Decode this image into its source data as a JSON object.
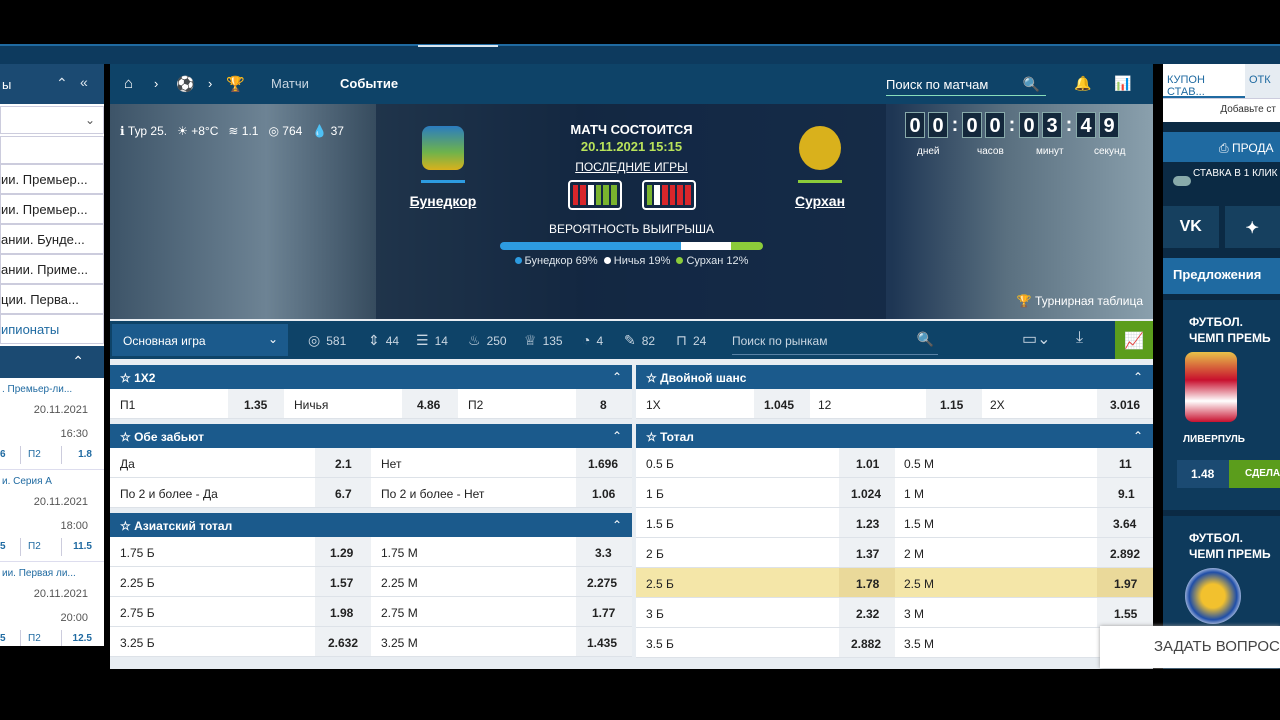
{
  "sidebar": {
    "header_text": "ы",
    "leagues": [
      "ии. Премьер...",
      "ии. Премьер...",
      "ании. Бунде...",
      "ании. Приме...",
      "ции. Перва..."
    ],
    "leagues_link": "ипионаты",
    "matches": [
      {
        "league": ". Премьер-ли...",
        "date": "20.11.2021",
        "time": "16:30",
        "v1": "6",
        "p2": "П2",
        "v2": "1.8"
      },
      {
        "league": "и. Серия А",
        "date": "20.11.2021",
        "time": "18:00",
        "v1": "5",
        "p2": "П2",
        "v2": "11.5"
      },
      {
        "league": "ии. Первая ли...",
        "date": "20.11.2021",
        "time": "20:00",
        "v1": "5",
        "p2": "П2",
        "v2": "12.5"
      }
    ]
  },
  "nav": {
    "matches": "Матчи",
    "event": "Событие",
    "search": "Поиск по матчам"
  },
  "hero": {
    "stats": {
      "round": "Тур 25.",
      "temp": "+8°C",
      "wind": "1.1",
      "pressure": "764",
      "humidity": "37"
    },
    "status": "МАТЧ СОСТОИТСЯ",
    "datetime": "20.11.2021 15:15",
    "last_games": "ПОСЛЕДНИЕ ИГРЫ",
    "win_prob": "ВЕРОЯТНОСТЬ ВЫИГРЫША",
    "home": "Бунедкор",
    "away": "Сурхан",
    "prob_home": "Бунедкор 69%",
    "prob_draw": "Ничья 19%",
    "prob_away": "Сурхан 12%",
    "prob_values": {
      "home": 69,
      "draw": 19,
      "away": 12
    },
    "timer_digits": [
      "0",
      "0",
      "0",
      "0",
      "0",
      "3",
      "4",
      "9"
    ],
    "timer_labels": [
      "дней",
      "часов",
      "минут",
      "секунд"
    ],
    "tournament": "Турнирная таблица"
  },
  "markets_bar": {
    "dropdown": "Основная игра",
    "filters": [
      "581",
      "44",
      "14",
      "250",
      "135",
      "4",
      "82",
      "24"
    ],
    "search": "Поиск по рынкам"
  },
  "t1x2": {
    "title": "1X2",
    "cells": [
      [
        "П1",
        "1.35"
      ],
      [
        "Ничья",
        "4.86"
      ],
      [
        "П2",
        "8"
      ]
    ]
  },
  "tboth": {
    "title": "Обе забьют",
    "rows": [
      [
        "Да",
        "2.1",
        "Нет",
        "1.696"
      ],
      [
        "По 2 и более - Да",
        "6.7",
        "По 2 и более - Нет",
        "1.06"
      ]
    ]
  },
  "tasian": {
    "title": "Азиатский тотал",
    "rows": [
      [
        "1.75 Б",
        "1.29",
        "1.75 М",
        "3.3"
      ],
      [
        "2.25 Б",
        "1.57",
        "2.25 М",
        "2.275"
      ],
      [
        "2.75 Б",
        "1.98",
        "2.75 М",
        "1.77"
      ],
      [
        "3.25 Б",
        "2.632",
        "3.25 М",
        "1.435"
      ]
    ]
  },
  "tdouble": {
    "title": "Двойной шанс",
    "cells": [
      [
        "1X",
        "1.045"
      ],
      [
        "12",
        "1.15"
      ],
      [
        "2X",
        "3.016"
      ]
    ]
  },
  "ttotal": {
    "title": "Тотал",
    "rows": [
      [
        "0.5 Б",
        "1.01",
        "0.5 М",
        "11"
      ],
      [
        "1 Б",
        "1.024",
        "1 М",
        "9.1"
      ],
      [
        "1.5 Б",
        "1.23",
        "1.5 М",
        "3.64"
      ],
      [
        "2 Б",
        "1.37",
        "2 М",
        "2.892"
      ],
      [
        "2.5 Б",
        "1.78",
        "2.5 М",
        "1.97"
      ],
      [
        "3 Б",
        "2.32",
        "3 М",
        "1.55"
      ],
      [
        "3.5 Б",
        "2.882",
        "3.5 М",
        ""
      ]
    ]
  },
  "right": {
    "tab1": "КУПОН СТАВ...",
    "tab2": "ОТК",
    "add": "Добавьте ст",
    "sell": "ПРОДА",
    "one_click": "СТАВКА В 1 КЛИК",
    "vk": "VK",
    "offers": "Предложения",
    "card1_title": "ФУТБОЛ. ЧЕМП ПРЕМЬ",
    "card1_team": "ЛИВЕРПУЛЬ",
    "card1_odd": "1.48",
    "card1_btn": "СДЕЛА",
    "card2_title": "ФУТБОЛ. ЧЕМП ПРЕМЬ"
  },
  "ask": "ЗАДАТЬ ВОПРОС"
}
